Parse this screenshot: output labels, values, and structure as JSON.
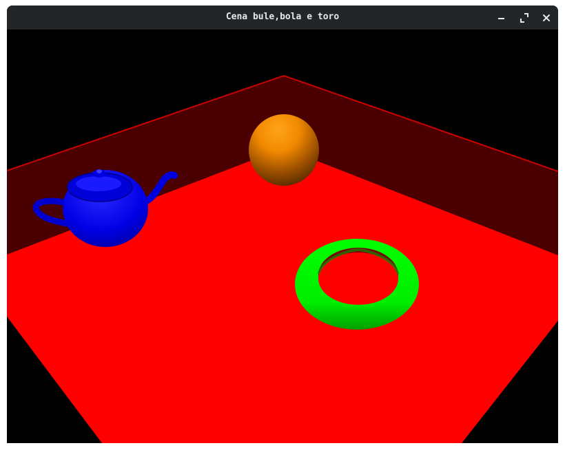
{
  "window": {
    "title": "Cena bule,bola e toro",
    "controls": {
      "minimize_icon": "minimize-icon",
      "maximize_icon": "maximize-icon",
      "close_icon": "close-icon"
    }
  },
  "scene": {
    "background_color": "#000000",
    "floor_color": "#ff0000",
    "wall_color": "#4a0000",
    "wall_edge_color": "#cc0000",
    "objects": [
      {
        "name": "teapot",
        "color": "#0000ff"
      },
      {
        "name": "sphere",
        "color": "#ff9000"
      },
      {
        "name": "torus",
        "color": "#00ff00"
      }
    ]
  }
}
